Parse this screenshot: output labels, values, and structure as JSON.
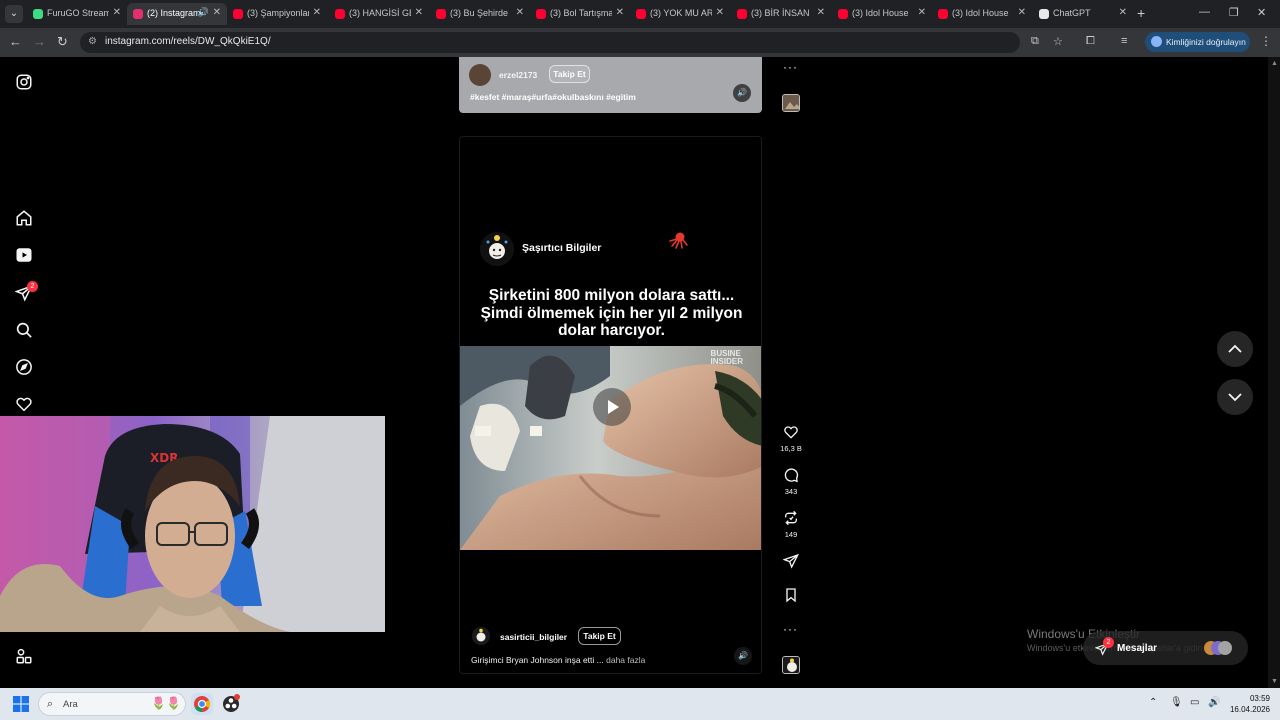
{
  "browser": {
    "tabs": [
      {
        "label": "FuruGO Stream",
        "favicon_color": "#3ddc84",
        "active": false
      },
      {
        "label": "(2) Instagram",
        "favicon_color": "#e1306c",
        "active": true
      },
      {
        "label": "(3) Şampiyonlar",
        "favicon_color": "#ff0033",
        "active": false
      },
      {
        "label": "(3) HANGİSİ GE",
        "favicon_color": "#ff0033",
        "active": false
      },
      {
        "label": "(3) Bu Şehirde",
        "favicon_color": "#ff0033",
        "active": false
      },
      {
        "label": "(3) Bol Tartışma",
        "favicon_color": "#ff0033",
        "active": false
      },
      {
        "label": "(3) YOK MU AR",
        "favicon_color": "#ff0033",
        "active": false
      },
      {
        "label": "(3) BİR İNSAN",
        "favicon_color": "#ff0033",
        "active": false
      },
      {
        "label": "(3) Idol House",
        "favicon_color": "#ff0033",
        "active": false
      },
      {
        "label": "(3) Idol House",
        "favicon_color": "#ff0033",
        "active": false
      },
      {
        "label": "ChatGPT",
        "favicon_color": "#e8e8e8",
        "active": false
      }
    ],
    "url": "instagram.com/reels/DW_QkQkiE1Q/",
    "profile_button": "Kimliğinizi doğrulayın"
  },
  "sidebar": {
    "items": [
      {
        "name": "instagram-logo-icon"
      },
      {
        "name": "home-icon"
      },
      {
        "name": "reels-icon"
      },
      {
        "name": "messages-icon",
        "badge": "2"
      },
      {
        "name": "search-icon"
      },
      {
        "name": "explore-icon"
      },
      {
        "name": "notifications-icon"
      },
      {
        "name": "more-menu-icon"
      }
    ]
  },
  "previous_reel": {
    "username": "erzel2173",
    "follow_label": "Takip Et",
    "caption": "#kesfet #maraş#urfa#okulbaskını #egitim"
  },
  "reel": {
    "channel_name": "Şaşırtıcı Bilgiler",
    "headline": "Şirketini 800 milyon dolara sattı... Şimdi ölmemek için her yıl 2 milyon dolar harcıyor.",
    "video_watermark_line1": "BUSINE",
    "video_watermark_line2": "INSIDER",
    "username": "sasirticii_bilgiler",
    "follow_label": "Takip Et",
    "caption": "Girişimci Bryan Johnson inşa etti ...",
    "caption_more": "daha fazla"
  },
  "actions": {
    "likes": "16,3 B",
    "comments": "343",
    "reposts": "149"
  },
  "overlay": {
    "activate_title": "Windows'u Etkinleştir",
    "activate_sub": "Windows'u etkinleştirmek için Ayarlar'a gidin.",
    "messages_label": "Mesajlar",
    "messages_badge": "2"
  },
  "taskbar": {
    "search_placeholder": "Ara",
    "time": "03:59",
    "date": "16.04.2026"
  },
  "colors": {
    "instagram_bg": "#000000",
    "badge_red": "#ff3040",
    "taskbar_bg": "#dfe6ee"
  }
}
